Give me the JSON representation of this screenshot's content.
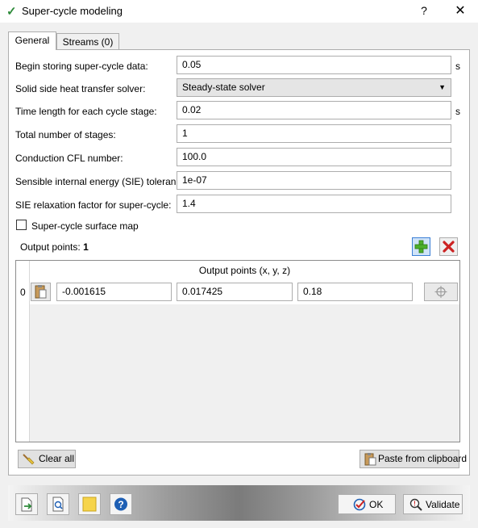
{
  "window": {
    "title": "Super-cycle modeling",
    "help": "?",
    "close": "✕"
  },
  "tabs": [
    {
      "label": "General",
      "active": true
    },
    {
      "label": "Streams (0)",
      "active": false
    }
  ],
  "form": {
    "begin_storing": {
      "label": "Begin storing super-cycle data:",
      "value": "0.05",
      "unit": "s"
    },
    "solver": {
      "label": "Solid side heat transfer solver:",
      "value": "Steady-state solver"
    },
    "time_length": {
      "label": "Time length for each cycle stage:",
      "value": "0.02",
      "unit": "s"
    },
    "total_stages": {
      "label": "Total number of stages:",
      "value": "1"
    },
    "cfl": {
      "label": "Conduction CFL number:",
      "value": "100.0"
    },
    "sie_tol": {
      "label": "Sensible internal energy (SIE) tolerance:",
      "value": "1e-07"
    },
    "sie_relax": {
      "label": "SIE relaxation factor for super-cycle:",
      "value": "1.4"
    },
    "surface_map": {
      "label": "Super-cycle surface map",
      "checked": false
    }
  },
  "output_points": {
    "label": "Output points:",
    "count": "1",
    "header": "Output points (x, y, z)",
    "rows": [
      {
        "index": "0",
        "x": "-0.001615",
        "y": "0.017425",
        "z": "0.18"
      }
    ]
  },
  "buttons": {
    "clear_all": "Clear all",
    "paste": "Paste from clipboard",
    "ok": "OK",
    "validate": "Validate"
  },
  "colors": {
    "accent_green": "#2e8b3a",
    "delete_red": "#cc2222",
    "help_blue": "#1e5fb4"
  }
}
